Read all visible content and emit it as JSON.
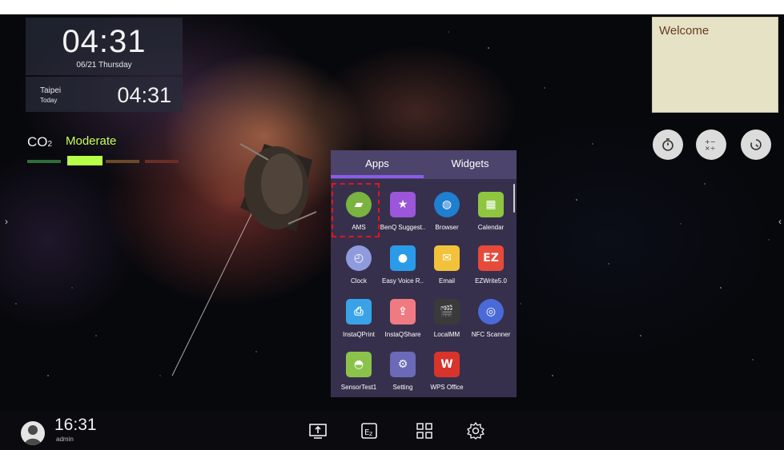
{
  "clock": {
    "time": "04:31",
    "date": "06/21 Thursday"
  },
  "world_clock": {
    "city": "Taipei",
    "day": "Today",
    "time": "04:31"
  },
  "co2": {
    "label": "CO",
    "subscript": "2",
    "status": "Moderate",
    "levels": [
      {
        "color": "#2f6e3a",
        "active": false
      },
      {
        "color": "#b8ff4a",
        "active": true
      },
      {
        "color": "#6b4a2a",
        "active": false
      },
      {
        "color": "#6a2e26",
        "active": false
      }
    ]
  },
  "note": {
    "text": "Welcome"
  },
  "tools": [
    {
      "name": "stopwatch-icon"
    },
    {
      "name": "calculator-icon"
    },
    {
      "name": "timer-icon"
    }
  ],
  "drawer": {
    "tabs": [
      {
        "label": "Apps",
        "active": true
      },
      {
        "label": "Widgets",
        "active": false
      }
    ],
    "apps": [
      {
        "label": "AMS",
        "icon": "ams-icon",
        "color": "#7ab33f"
      },
      {
        "label": "BenQ Suggest..",
        "icon": "benq-suggest-icon",
        "color": "#9b56d9"
      },
      {
        "label": "Browser",
        "icon": "browser-icon",
        "color": "#1f7fd0"
      },
      {
        "label": "Calendar",
        "icon": "calendar-icon",
        "color": "#8ec63f"
      },
      {
        "label": "Clock",
        "icon": "clock-icon",
        "color": "#8f9bdc"
      },
      {
        "label": "Easy Voice R..",
        "icon": "microphone-icon",
        "color": "#2a9be8"
      },
      {
        "label": "Email",
        "icon": "email-icon",
        "color": "#f2c23a"
      },
      {
        "label": "EZWrite5.0",
        "icon": "ezwrite-icon",
        "color": "#e64a3a"
      },
      {
        "label": "InstaQPrint",
        "icon": "printer-icon",
        "color": "#3aa3e8"
      },
      {
        "label": "InstaQShare",
        "icon": "share-icon",
        "color": "#f07a82"
      },
      {
        "label": "LocalMM",
        "icon": "clapperboard-icon",
        "color": "#3a3a3a"
      },
      {
        "label": "NFC Scanner",
        "icon": "nfc-icon",
        "color": "#4a6ad8"
      },
      {
        "label": "SensorTest1",
        "icon": "android-icon",
        "color": "#8bc34a"
      },
      {
        "label": "Setting",
        "icon": "settings-icon",
        "color": "#6a6ab8"
      },
      {
        "label": "WPS Office",
        "icon": "wps-office-icon",
        "color": "#d9342b"
      }
    ]
  },
  "status_bar": {
    "time": "16:31",
    "user": "admin"
  },
  "dock": [
    {
      "name": "screen-share-icon"
    },
    {
      "name": "ezwrite-icon"
    },
    {
      "name": "apps-grid-icon"
    },
    {
      "name": "settings-gear-icon"
    }
  ]
}
